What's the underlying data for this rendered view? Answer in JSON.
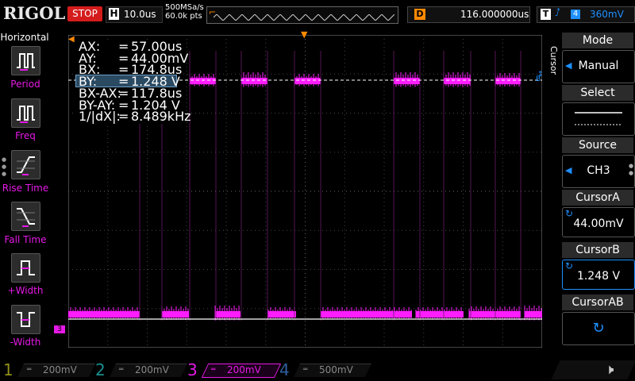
{
  "topbar": {
    "brand": "RIGOL",
    "run_state": "STOP",
    "timebase_label": "H",
    "timebase_value": "10.0us",
    "sample_rate": "500MSa/s",
    "memory_depth": "60.0k pts",
    "delay_label": "D",
    "delay_value": "116.000000us",
    "trigger_label": "T",
    "trigger_source": "4",
    "trigger_level": "360mV"
  },
  "leftpanel": {
    "title": "Horizontal",
    "items": [
      {
        "label": "Period",
        "icon": "period-icon"
      },
      {
        "label": "Freq",
        "icon": "freq-icon"
      },
      {
        "label": "Rise Time",
        "icon": "rise-time-icon"
      },
      {
        "label": "Fall Time",
        "icon": "fall-time-icon"
      },
      {
        "label": "+Width",
        "icon": "pos-width-icon"
      },
      {
        "label": "-Width",
        "icon": "neg-width-icon"
      }
    ]
  },
  "readout": {
    "rows": [
      {
        "k": "AX:",
        "v": "57.00us"
      },
      {
        "k": "AY:",
        "v": "44.00mV"
      },
      {
        "k": "BX:",
        "v": "174.8us"
      },
      {
        "k": "BY:",
        "v": "1.248 V"
      },
      {
        "k": "BX-AX:",
        "v": "117.8us"
      },
      {
        "k": "BY-AY:",
        "v": "1.204 V"
      },
      {
        "k": "1/|dX|:",
        "v": "8.489kHz"
      }
    ],
    "eq": "="
  },
  "right_menu": {
    "side_label": "Cursor",
    "mode": {
      "title": "Mode",
      "value": "Manual"
    },
    "select": {
      "title": "Select"
    },
    "source": {
      "title": "Source",
      "value": "CH3"
    },
    "cursor_a": {
      "title": "CursorA",
      "value": "44.00mV"
    },
    "cursor_b": {
      "title": "CursorB",
      "value": "1.248 V"
    },
    "cursor_ab": {
      "title": "CursorAB"
    }
  },
  "channels": [
    {
      "num": "1",
      "scale": "200mV",
      "color": "#8f8f1a",
      "active": false
    },
    {
      "num": "2",
      "scale": "200mV",
      "color": "#1a8f8f",
      "active": false
    },
    {
      "num": "3",
      "scale": "200mV",
      "color": "#e619e6",
      "active": true
    },
    {
      "num": "4",
      "scale": "500mV",
      "color": "#2f5fa0",
      "active": false
    }
  ],
  "markers": {
    "ch3_marker": "3",
    "trigger_marker": "T",
    "cursor_b_marker": "B"
  },
  "colors": {
    "ch3": "#ff1dff",
    "accent": "#1e90ff",
    "trigger": "#ff8a00",
    "stop": "#d41c1c"
  }
}
